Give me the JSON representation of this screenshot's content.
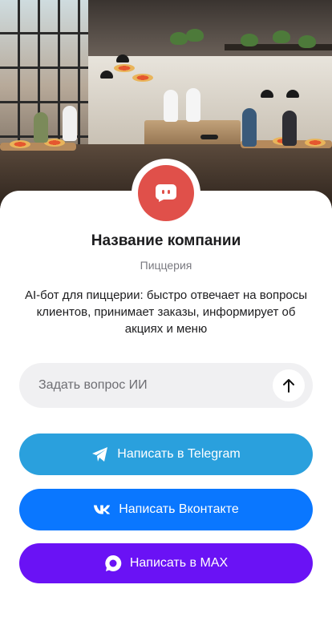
{
  "company": {
    "name": "Название компании",
    "type": "Пиццерия",
    "description": "AI-бот для пиццерии: быстро отвечает на вопросы клиентов, принимает заказы, информирует об акциях и меню",
    "avatar_color": "#e0504a"
  },
  "ask": {
    "placeholder": "Задать вопрос ИИ",
    "value": "",
    "send_icon": "arrow-up-icon"
  },
  "buttons": {
    "telegram": {
      "label": "Написать в Telegram",
      "icon": "telegram-icon",
      "color": "#2aa0dd"
    },
    "vk": {
      "label": "Написать Вконтакте",
      "icon": "vk-icon",
      "color": "#0a77ff"
    },
    "max": {
      "label": "Написать в MAX",
      "icon": "max-icon",
      "color": "#6a12f5"
    }
  }
}
